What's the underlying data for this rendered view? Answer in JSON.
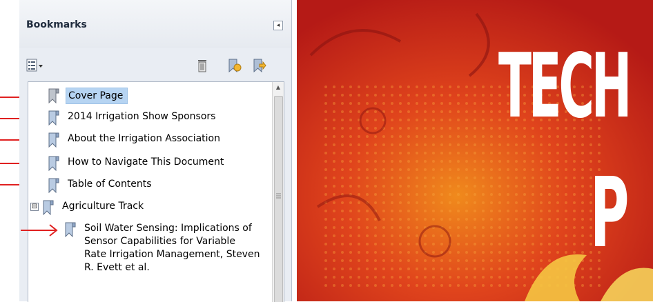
{
  "panel": {
    "title": "Bookmarks",
    "collapse_glyph": "◂",
    "toolbar": {
      "options_icon": "options-menu-icon",
      "delete_icon": "trash-icon",
      "new_bookmark_icon": "new-bookmark-icon",
      "expand_bookmark_icon": "bookmark-arrow-icon"
    }
  },
  "bookmarks": [
    {
      "label": "Cover Page",
      "selected": true
    },
    {
      "label": "2014 Irrigation Show Sponsors"
    },
    {
      "label": "About the Irrigation Association"
    },
    {
      "label": "How to Navigate This Document"
    },
    {
      "label": "Table of Contents"
    },
    {
      "label": "Agriculture Track",
      "expander": "⊟"
    },
    {
      "label": "Soil Water Sensing: Implications of Sensor Capabilities for Variable Rate Irrigation Management, Steven R. Evett et al."
    }
  ],
  "document": {
    "title_line1": "TECH",
    "title_line2": "P"
  },
  "colors": {
    "accent_red": "#e02020",
    "selection": "#b6d4f2",
    "document_bg": "#c9261a"
  }
}
